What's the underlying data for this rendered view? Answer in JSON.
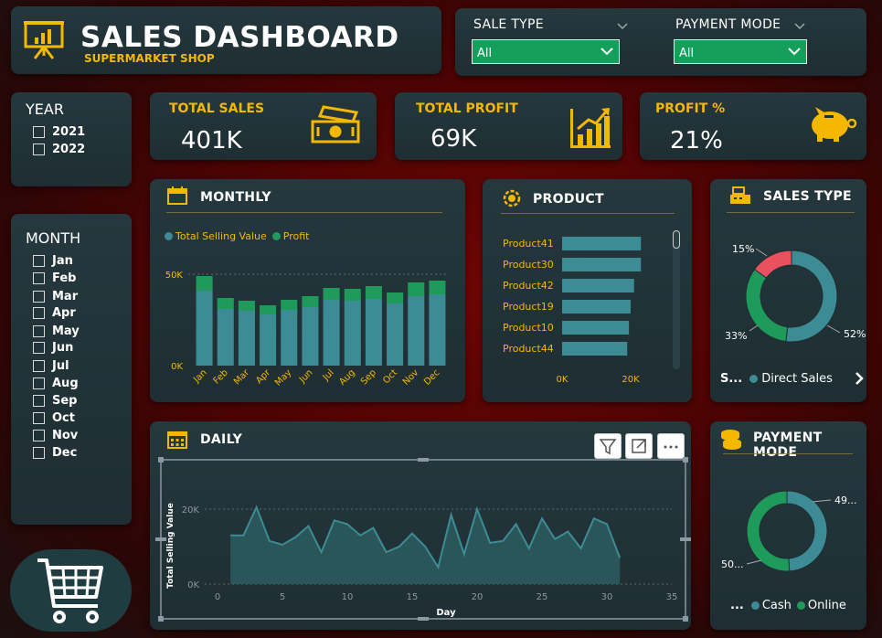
{
  "header": {
    "title": "SALES DASHBOARD",
    "subtitle": "SUPERMARKET SHOP",
    "logo_icon": "presentation-chart-icon"
  },
  "slicers": {
    "sale_type": {
      "label": "SALE TYPE",
      "value": "All"
    },
    "payment_mode": {
      "label": "PAYMENT MODE",
      "value": "All"
    }
  },
  "year_filter": {
    "title": "YEAR",
    "items": [
      "2021",
      "2022"
    ]
  },
  "month_filter": {
    "title": "MONTH",
    "items": [
      "Jan",
      "Feb",
      "Mar",
      "Apr",
      "May",
      "Jun",
      "Jul",
      "Aug",
      "Sep",
      "Oct",
      "Nov",
      "Dec"
    ]
  },
  "kpis": {
    "total_sales": {
      "title": "TOTAL SALES",
      "value": "401K",
      "icon": "money-icon"
    },
    "total_profit": {
      "title": "TOTAL PROFIT",
      "value": "69K",
      "icon": "growth-chart-icon"
    },
    "profit_pct": {
      "title": "PROFIT %",
      "value": "21%",
      "icon": "piggy-bank-icon"
    }
  },
  "monthly": {
    "title": "MONTHLY",
    "legend": [
      "Total Selling Value",
      "Profit"
    ]
  },
  "product": {
    "title": "PRODUCT"
  },
  "sales_type": {
    "title": "SALES TYPE",
    "legend_prefix": "S...",
    "legend_item": "Direct Sales"
  },
  "daily": {
    "title": "DAILY"
  },
  "payment_mode": {
    "title": "PAYMENT MODE",
    "legend_prefix": "...",
    "legend_items": [
      "Cash",
      "Online"
    ]
  },
  "colors": {
    "teal": "#3d8b94",
    "green": "#1e9a5a",
    "red": "#e8515d",
    "gold": "#f5b800"
  },
  "chart_data": [
    {
      "type": "bar",
      "title": "MONTHLY",
      "categories": [
        "Jan",
        "Feb",
        "Mar",
        "Apr",
        "May",
        "Jun",
        "Jul",
        "Aug",
        "Sep",
        "Oct",
        "Nov",
        "Dec"
      ],
      "series": [
        {
          "name": "Total Selling Value",
          "values": [
            41000,
            31000,
            30000,
            28000,
            30500,
            32000,
            36000,
            35500,
            36500,
            34000,
            38000,
            39000
          ]
        },
        {
          "name": "Profit",
          "values": [
            8000,
            6000,
            5500,
            5000,
            5500,
            6000,
            6500,
            6500,
            7000,
            6000,
            7500,
            7500
          ]
        }
      ],
      "stacked": true,
      "ylim": [
        0,
        50000
      ],
      "yticks": [
        "0K",
        "50K"
      ],
      "legend": "top-left"
    },
    {
      "type": "bar",
      "orientation": "horizontal",
      "title": "PRODUCT",
      "categories": [
        "Product41",
        "Product30",
        "Product42",
        "Product19",
        "Product10",
        "Product44"
      ],
      "values": [
        23000,
        23000,
        21000,
        20000,
        19500,
        19000
      ],
      "xlim": [
        0,
        20000
      ],
      "xticks": [
        "0K",
        "20K"
      ]
    },
    {
      "type": "pie",
      "donut": true,
      "title": "SALES TYPE",
      "slices": [
        {
          "value": 52,
          "label": "52%",
          "color": "#3d8b94"
        },
        {
          "value": 33,
          "label": "33%",
          "color": "#1e9a5a"
        },
        {
          "value": 15,
          "label": "15%",
          "color": "#e8515d"
        }
      ]
    },
    {
      "type": "area",
      "title": "DAILY",
      "ylabel": "Total Selling Value",
      "xlabel": "Day",
      "x": [
        1,
        2,
        3,
        4,
        5,
        6,
        7,
        8,
        9,
        10,
        11,
        12,
        13,
        14,
        15,
        16,
        17,
        18,
        19,
        20,
        21,
        22,
        23,
        24,
        25,
        26,
        27,
        28,
        29,
        30,
        31
      ],
      "y": [
        13000,
        13000,
        20500,
        11500,
        10500,
        12500,
        15500,
        8500,
        17000,
        16000,
        13000,
        15000,
        8500,
        10000,
        13500,
        10000,
        4500,
        18500,
        8000,
        20000,
        11000,
        11500,
        16000,
        9500,
        17500,
        12000,
        14000,
        9500,
        17500,
        16000,
        7000
      ],
      "xlim": [
        0,
        35
      ],
      "ylim": [
        0,
        20000
      ],
      "xticks": [
        0,
        5,
        10,
        15,
        20,
        25,
        30,
        35
      ],
      "yticks": [
        "0K",
        "20K"
      ]
    },
    {
      "type": "pie",
      "donut": true,
      "title": "PAYMENT MODE",
      "slices": [
        {
          "value": 49,
          "label": "49...",
          "color": "#3d8b94"
        },
        {
          "value": 51,
          "label": "50...",
          "color": "#1e9a5a"
        }
      ]
    }
  ]
}
